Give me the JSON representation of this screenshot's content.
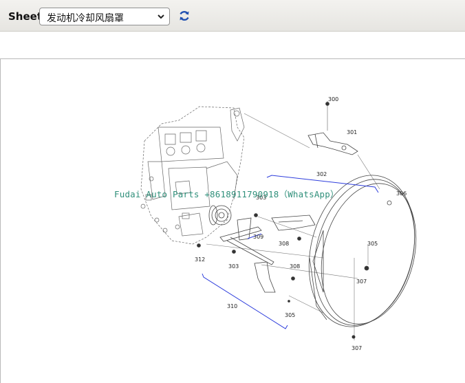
{
  "toolbar": {
    "sheet_label": "Sheet",
    "sheet_selected": "发动机冷却风扇罩",
    "refresh_icon": "refresh-icon"
  },
  "diagram": {
    "callouts": {
      "c300": "300",
      "c301": "301",
      "c302": "302",
      "c303": "303",
      "c303b": "303",
      "c305a": "305",
      "c305b": "305",
      "c306": "306",
      "c307a": "307",
      "c307b": "307",
      "c308a": "308",
      "c308b": "308",
      "c309": "309",
      "c310": "310",
      "c312": "312"
    },
    "watermark": "Fudai Auto Parts +8618911790918（WhatsApp）"
  },
  "colors": {
    "toolbar_bg": "#ecebe8",
    "refresh_blue": "#1f4fb0",
    "leader_blue": "#2b3bdc",
    "watermark": "#2f8f7a"
  }
}
